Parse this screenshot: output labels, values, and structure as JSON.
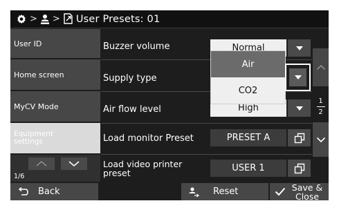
{
  "header": {
    "title": "User Presets: 01",
    "icons": [
      "gear-icon",
      "user-icon",
      "document-arrow-icon"
    ],
    "separator": ">"
  },
  "sidebar": {
    "items": [
      {
        "label": "User ID",
        "active": false
      },
      {
        "label": "Home screen",
        "active": false
      },
      {
        "label": "MyCV Mode",
        "active": false
      },
      {
        "label": "Equipment settings",
        "active": true
      }
    ],
    "page_indicator": "1/6"
  },
  "rows": [
    {
      "label": "Buzzer volume",
      "value": "Normal"
    },
    {
      "label": "Supply type",
      "value": "Air"
    },
    {
      "label": "Air flow level",
      "value": "High"
    },
    {
      "label": "Load monitor Preset",
      "value": "PRESET A"
    },
    {
      "label": "Load video printer preset",
      "value": "USER 1"
    }
  ],
  "dropdown": {
    "options": [
      "Air",
      "CO2"
    ],
    "selected": "Air"
  },
  "scroll": {
    "current": "1",
    "total": "2"
  },
  "footer": {
    "back_label": "Back",
    "reset_label": "Reset",
    "save_label": "Save & Close"
  },
  "colors": {
    "background": "#1d1d1d",
    "panel": "#474747",
    "value_box": "#efefef",
    "highlight": "#ffffff",
    "active_sidebar": "#dadada"
  }
}
